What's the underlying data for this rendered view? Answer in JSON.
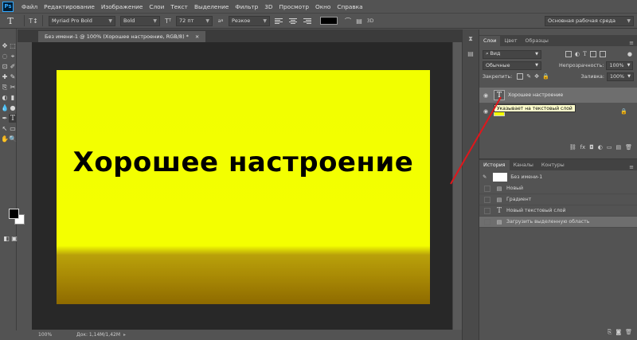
{
  "app": {
    "logo": "Ps"
  },
  "menu": [
    "Файл",
    "Редактирование",
    "Изображение",
    "Слои",
    "Текст",
    "Выделение",
    "Фильтр",
    "3D",
    "Просмотр",
    "Окно",
    "Справка"
  ],
  "options": {
    "tool_glyph": "T",
    "orient_icon": "T↕",
    "font_family": "Myriad Pro Bold",
    "font_style": "Bold",
    "font_size": "72 пт",
    "antialias": "Резкое",
    "text_color": "#000000",
    "workspace": "Основная рабочая среда"
  },
  "document": {
    "tab_title": "Без имени-1 @ 100% (Хорошее настроение, RGB/8) *",
    "close": "×",
    "text": "Хорошее настроение",
    "zoom": "100%",
    "doc_size": "Док: 1,14M/1,42M"
  },
  "tools": [
    "✥",
    "⬚",
    "◌",
    "⌖",
    "⊡",
    "✐",
    "✚",
    "✎",
    "⎘",
    "✂",
    "◐",
    "▮",
    "💧",
    "●",
    "✒",
    "T",
    "↖",
    "▭",
    "✋",
    "🔍"
  ],
  "tools_extra": [
    "◧",
    "▣",
    "▭",
    "▦"
  ],
  "layers_panel": {
    "tabs": [
      "Слои",
      "Цвет",
      "Образцы"
    ],
    "filter_label": "Вид",
    "blend_mode": "Обычные",
    "opacity_label": "Непрозрачность:",
    "opacity_value": "100%",
    "lock_label": "Закрепить:",
    "fill_label": "Заливка:",
    "fill_value": "100%",
    "layers": [
      {
        "name": "Хорошее настроение",
        "thumb": "T",
        "selected": true
      },
      {
        "name": "",
        "thumb": "",
        "selected": false
      }
    ],
    "tooltip": "Указывает на текстовый слой",
    "bottom_icons": [
      "⛓",
      "fx",
      "◘",
      "◐",
      "▭",
      "▤",
      "🗑"
    ]
  },
  "history_panel": {
    "tabs": [
      "История",
      "Каналы",
      "Контуры"
    ],
    "snapshot": "Без имени-1",
    "items": [
      {
        "label": "Новый",
        "icon": "▤",
        "selected": false
      },
      {
        "label": "Градиент",
        "icon": "▤",
        "selected": false
      },
      {
        "label": "Новый текстовый слой",
        "icon": "T",
        "selected": false
      },
      {
        "label": "Загрузить выделенную область",
        "icon": "▤",
        "selected": true
      }
    ],
    "bottom_icons": [
      "⎘",
      "◙",
      "🗑"
    ]
  },
  "colors": {
    "accent_blue": "#31a8ff",
    "canvas_yellow": "#f4ff00",
    "annotation_red": "#e0161b",
    "tooltip_bg": "#ffffcc"
  }
}
